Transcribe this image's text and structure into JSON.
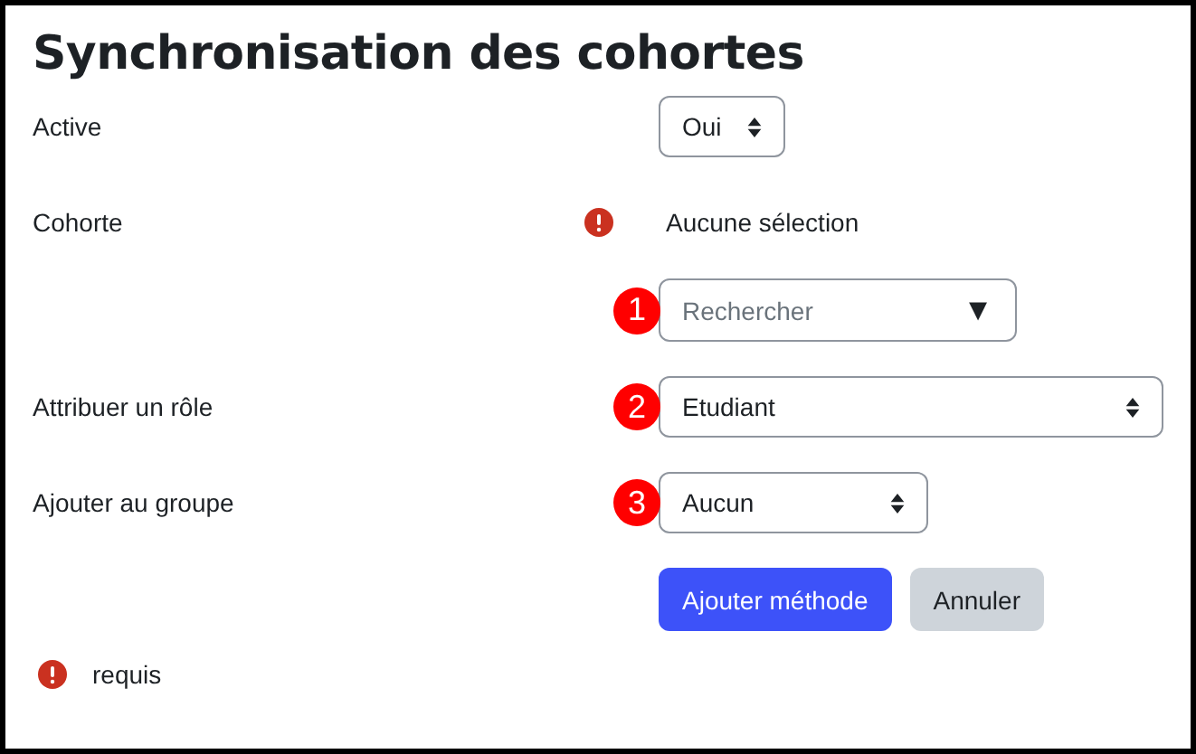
{
  "title": "Synchronisation des cohortes",
  "fields": [
    {
      "label": "Active",
      "kind": "select",
      "value": "Oui"
    },
    {
      "label": "Cohorte",
      "kind": "static",
      "value": "Aucune sélection",
      "required": true
    },
    {
      "kind": "autocomplete",
      "placeholder": "Rechercher",
      "callout": "1",
      "caret": "▼"
    },
    {
      "label": "Attribuer un rôle",
      "kind": "select",
      "value": "Etudiant",
      "callout": "2"
    },
    {
      "label": "Ajouter au groupe",
      "kind": "select",
      "value": "Aucun",
      "callout": "3"
    }
  ],
  "buttons": [
    {
      "label": "Ajouter méthode",
      "primary": true
    },
    {
      "label": "Annuler",
      "primary": false
    }
  ],
  "footnote": "requis"
}
